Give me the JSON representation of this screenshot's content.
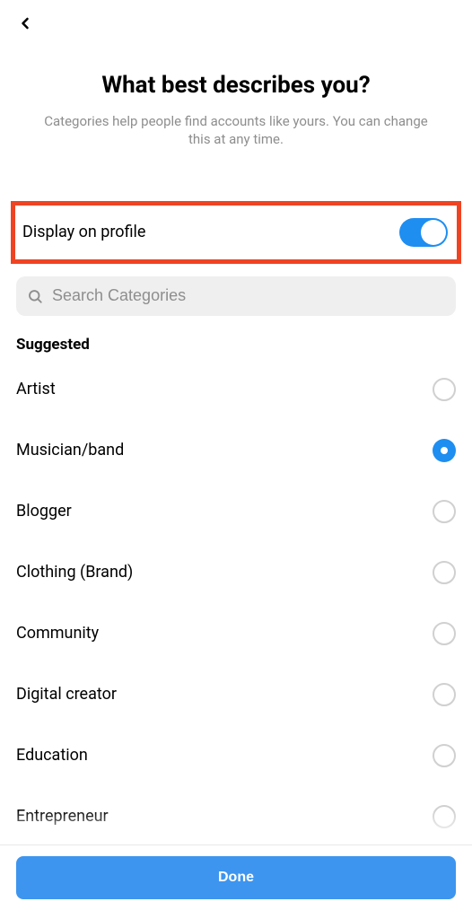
{
  "header": {
    "title": "What best describes you?",
    "subtitle": "Categories help people find accounts like yours. You can change this at any time."
  },
  "display_toggle": {
    "label": "Display on profile",
    "on": true
  },
  "search": {
    "placeholder": "Search Categories"
  },
  "section_title": "Suggested",
  "categories": [
    {
      "label": "Artist",
      "selected": false
    },
    {
      "label": "Musician/band",
      "selected": true
    },
    {
      "label": "Blogger",
      "selected": false
    },
    {
      "label": "Clothing (Brand)",
      "selected": false
    },
    {
      "label": "Community",
      "selected": false
    },
    {
      "label": "Digital creator",
      "selected": false
    },
    {
      "label": "Education",
      "selected": false
    },
    {
      "label": "Entrepreneur",
      "selected": false
    }
  ],
  "footer": {
    "done_label": "Done"
  }
}
